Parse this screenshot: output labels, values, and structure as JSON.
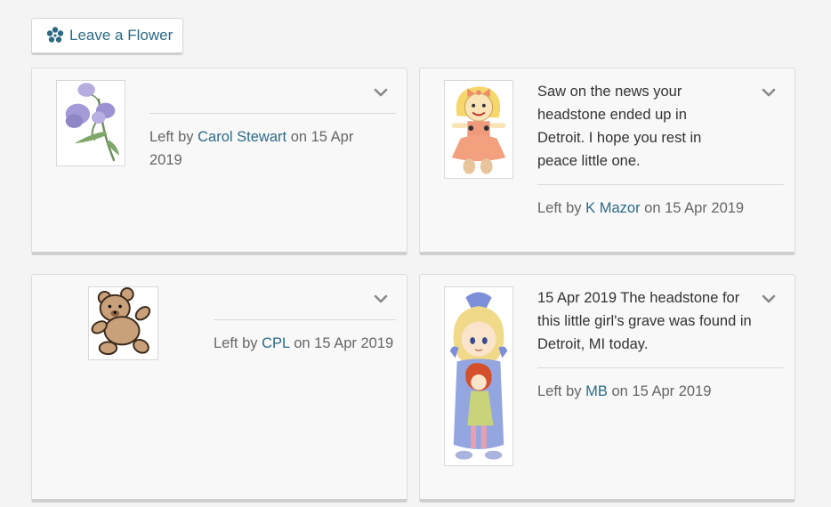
{
  "leave_flower_button": {
    "label": "Leave a Flower",
    "icon": "flower-icon"
  },
  "memorials": [
    {
      "image": "sweet-pea-flower-image",
      "message": "",
      "left_by_prefix": "Left by",
      "author": "Carol Stewart",
      "date_text": "on 15 Apr 2019"
    },
    {
      "image": "rag-doll-image",
      "message": "Saw on the news your headstone ended up in Detroit. I hope you rest in peace little one.",
      "left_by_prefix": "Left by",
      "author": "K Mazor",
      "date_text": "on 15 Apr 2019"
    },
    {
      "image": "teddy-bear-image",
      "message": "",
      "left_by_prefix": "Left by",
      "author": "CPL",
      "date_text": "on 15 Apr 2019"
    },
    {
      "image": "girl-holding-doll-image",
      "message": "15 Apr 2019 The headstone for this little girl's grave was found in Detroit, MI today.",
      "left_by_prefix": "Left by",
      "author": "MB",
      "date_text": "on 15 Apr 2019"
    }
  ],
  "colors": {
    "link": "#2c6a86",
    "card_bg": "#f8f8f8",
    "page_bg": "#f4f4f4"
  }
}
